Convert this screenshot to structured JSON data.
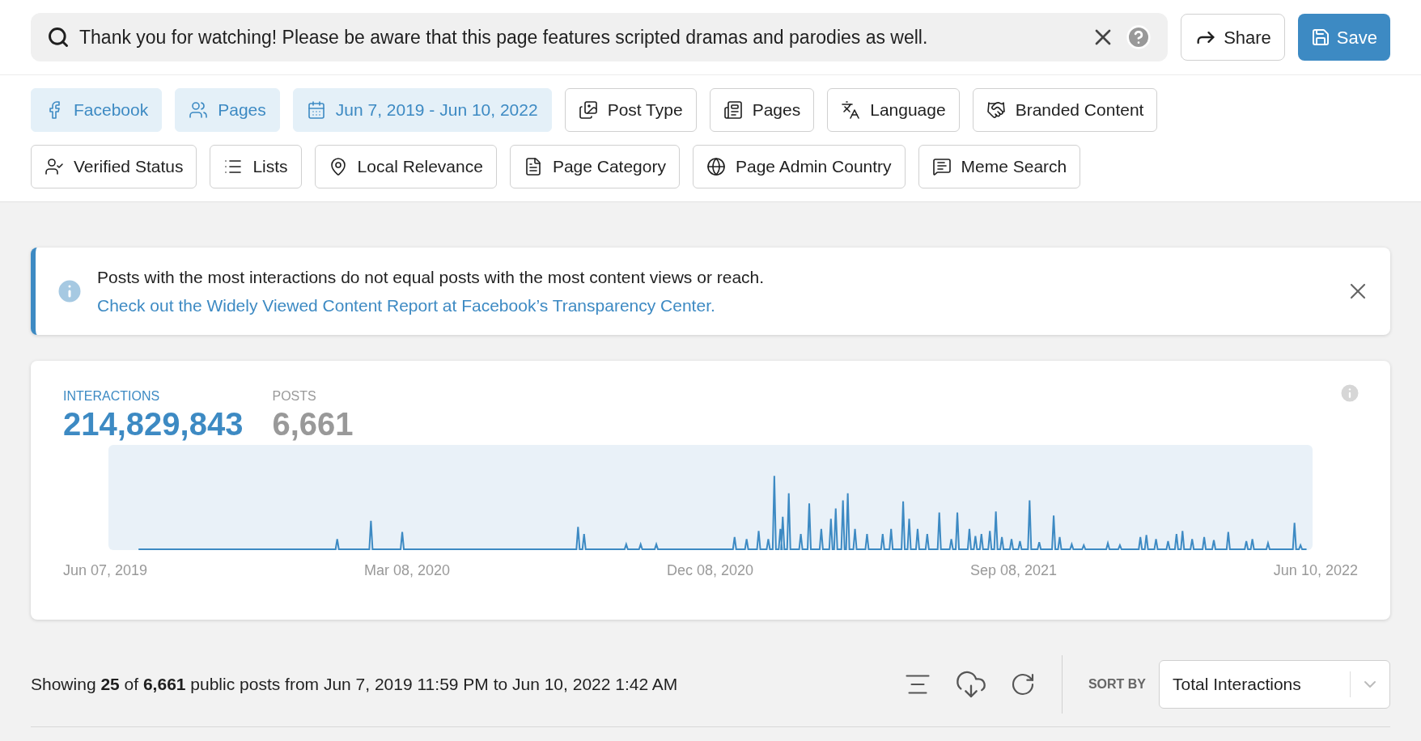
{
  "search": {
    "value": "Thank you for watching! Please be aware that this page features scripted dramas and parodies as well."
  },
  "header_buttons": [
    {
      "label": "Share",
      "kind": "secondary"
    },
    {
      "label": "Save",
      "kind": "primary"
    }
  ],
  "filter_rows": [
    [
      {
        "label": "Facebook",
        "active": true
      },
      {
        "label": "Pages",
        "active": true
      },
      {
        "label": "Jun 7, 2019 - Jun 10, 2022",
        "active": true
      },
      {
        "label": "Post Type",
        "active": false
      },
      {
        "label": "Pages",
        "active": false
      },
      {
        "label": "Language",
        "active": false
      },
      {
        "label": "Branded Content",
        "active": false
      }
    ],
    [
      {
        "label": "Verified Status",
        "active": false
      },
      {
        "label": "Lists",
        "active": false
      },
      {
        "label": "Local Relevance",
        "active": false
      },
      {
        "label": "Page Category",
        "active": false
      },
      {
        "label": "Page Admin Country",
        "active": false
      },
      {
        "label": "Meme Search",
        "active": false
      }
    ]
  ],
  "notice": {
    "text": "Posts with the most interactions do not equal posts with the most content views or reach.",
    "link": "Check out the Widely Viewed Content Report at Facebook’s Transparency Center."
  },
  "stats": [
    {
      "label": "INTERACTIONS",
      "value": "214,829,843",
      "selected": true
    },
    {
      "label": "POSTS",
      "value": "6,661",
      "selected": false
    }
  ],
  "chart_axis_labels": [
    "Jun 07, 2019",
    "Mar 08, 2020",
    "Dec 08, 2020",
    "Sep 08, 2021",
    "Jun 10, 2022"
  ],
  "results_summary": "Showing **25** of **6,661** public posts from Jun 7, 2019 11:59 PM to Jun 10, 2022 1:42 AM",
  "sort": {
    "label": "SORT BY",
    "value": "Total Interactions"
  }
}
